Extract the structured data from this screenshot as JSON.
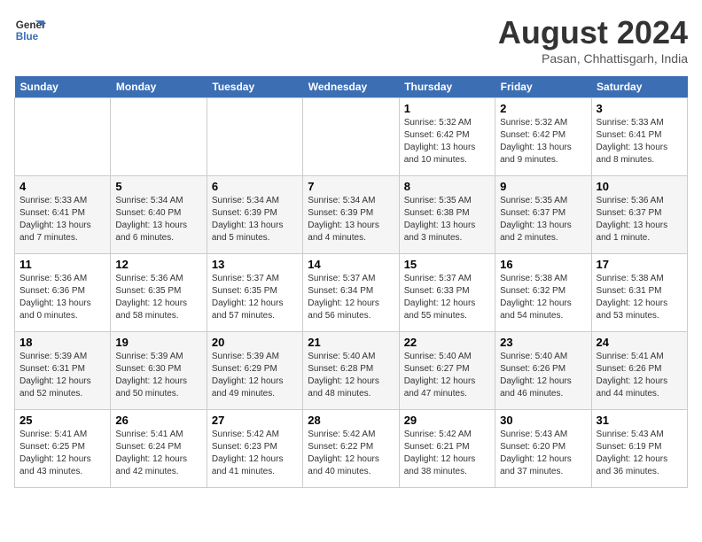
{
  "logo": {
    "line1": "General",
    "line2": "Blue"
  },
  "title": "August 2024",
  "subtitle": "Pasan, Chhattisgarh, India",
  "weekdays": [
    "Sunday",
    "Monday",
    "Tuesday",
    "Wednesday",
    "Thursday",
    "Friday",
    "Saturday"
  ],
  "weeks": [
    [
      {
        "day": "",
        "info": ""
      },
      {
        "day": "",
        "info": ""
      },
      {
        "day": "",
        "info": ""
      },
      {
        "day": "",
        "info": ""
      },
      {
        "day": "1",
        "info": "Sunrise: 5:32 AM\nSunset: 6:42 PM\nDaylight: 13 hours and 10 minutes."
      },
      {
        "day": "2",
        "info": "Sunrise: 5:32 AM\nSunset: 6:42 PM\nDaylight: 13 hours and 9 minutes."
      },
      {
        "day": "3",
        "info": "Sunrise: 5:33 AM\nSunset: 6:41 PM\nDaylight: 13 hours and 8 minutes."
      }
    ],
    [
      {
        "day": "4",
        "info": "Sunrise: 5:33 AM\nSunset: 6:41 PM\nDaylight: 13 hours and 7 minutes."
      },
      {
        "day": "5",
        "info": "Sunrise: 5:34 AM\nSunset: 6:40 PM\nDaylight: 13 hours and 6 minutes."
      },
      {
        "day": "6",
        "info": "Sunrise: 5:34 AM\nSunset: 6:39 PM\nDaylight: 13 hours and 5 minutes."
      },
      {
        "day": "7",
        "info": "Sunrise: 5:34 AM\nSunset: 6:39 PM\nDaylight: 13 hours and 4 minutes."
      },
      {
        "day": "8",
        "info": "Sunrise: 5:35 AM\nSunset: 6:38 PM\nDaylight: 13 hours and 3 minutes."
      },
      {
        "day": "9",
        "info": "Sunrise: 5:35 AM\nSunset: 6:37 PM\nDaylight: 13 hours and 2 minutes."
      },
      {
        "day": "10",
        "info": "Sunrise: 5:36 AM\nSunset: 6:37 PM\nDaylight: 13 hours and 1 minute."
      }
    ],
    [
      {
        "day": "11",
        "info": "Sunrise: 5:36 AM\nSunset: 6:36 PM\nDaylight: 13 hours and 0 minutes."
      },
      {
        "day": "12",
        "info": "Sunrise: 5:36 AM\nSunset: 6:35 PM\nDaylight: 12 hours and 58 minutes."
      },
      {
        "day": "13",
        "info": "Sunrise: 5:37 AM\nSunset: 6:35 PM\nDaylight: 12 hours and 57 minutes."
      },
      {
        "day": "14",
        "info": "Sunrise: 5:37 AM\nSunset: 6:34 PM\nDaylight: 12 hours and 56 minutes."
      },
      {
        "day": "15",
        "info": "Sunrise: 5:37 AM\nSunset: 6:33 PM\nDaylight: 12 hours and 55 minutes."
      },
      {
        "day": "16",
        "info": "Sunrise: 5:38 AM\nSunset: 6:32 PM\nDaylight: 12 hours and 54 minutes."
      },
      {
        "day": "17",
        "info": "Sunrise: 5:38 AM\nSunset: 6:31 PM\nDaylight: 12 hours and 53 minutes."
      }
    ],
    [
      {
        "day": "18",
        "info": "Sunrise: 5:39 AM\nSunset: 6:31 PM\nDaylight: 12 hours and 52 minutes."
      },
      {
        "day": "19",
        "info": "Sunrise: 5:39 AM\nSunset: 6:30 PM\nDaylight: 12 hours and 50 minutes."
      },
      {
        "day": "20",
        "info": "Sunrise: 5:39 AM\nSunset: 6:29 PM\nDaylight: 12 hours and 49 minutes."
      },
      {
        "day": "21",
        "info": "Sunrise: 5:40 AM\nSunset: 6:28 PM\nDaylight: 12 hours and 48 minutes."
      },
      {
        "day": "22",
        "info": "Sunrise: 5:40 AM\nSunset: 6:27 PM\nDaylight: 12 hours and 47 minutes."
      },
      {
        "day": "23",
        "info": "Sunrise: 5:40 AM\nSunset: 6:26 PM\nDaylight: 12 hours and 46 minutes."
      },
      {
        "day": "24",
        "info": "Sunrise: 5:41 AM\nSunset: 6:26 PM\nDaylight: 12 hours and 44 minutes."
      }
    ],
    [
      {
        "day": "25",
        "info": "Sunrise: 5:41 AM\nSunset: 6:25 PM\nDaylight: 12 hours and 43 minutes."
      },
      {
        "day": "26",
        "info": "Sunrise: 5:41 AM\nSunset: 6:24 PM\nDaylight: 12 hours and 42 minutes."
      },
      {
        "day": "27",
        "info": "Sunrise: 5:42 AM\nSunset: 6:23 PM\nDaylight: 12 hours and 41 minutes."
      },
      {
        "day": "28",
        "info": "Sunrise: 5:42 AM\nSunset: 6:22 PM\nDaylight: 12 hours and 40 minutes."
      },
      {
        "day": "29",
        "info": "Sunrise: 5:42 AM\nSunset: 6:21 PM\nDaylight: 12 hours and 38 minutes."
      },
      {
        "day": "30",
        "info": "Sunrise: 5:43 AM\nSunset: 6:20 PM\nDaylight: 12 hours and 37 minutes."
      },
      {
        "day": "31",
        "info": "Sunrise: 5:43 AM\nSunset: 6:19 PM\nDaylight: 12 hours and 36 minutes."
      }
    ]
  ]
}
